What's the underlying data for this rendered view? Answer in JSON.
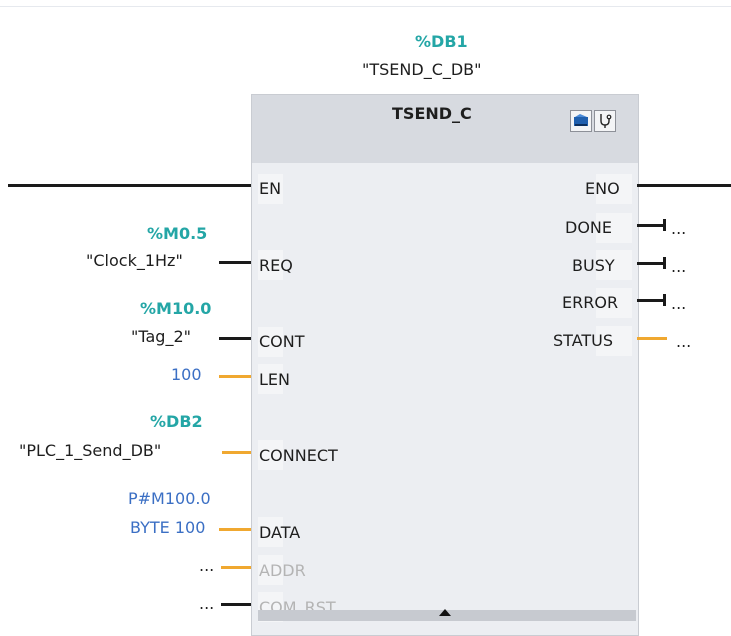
{
  "block": {
    "instance_address": "%DB1",
    "instance_name": "\"TSEND_C_DB\"",
    "type_name": "TSEND_C",
    "icons": [
      "open-block-icon",
      "diagnostics-icon"
    ]
  },
  "inputs": {
    "en": "EN",
    "req": {
      "pin": "REQ",
      "address": "%M0.5",
      "tag": "\"Clock_1Hz\""
    },
    "cont": {
      "pin": "CONT",
      "address": "%M10.0",
      "tag": "\"Tag_2\""
    },
    "len": {
      "pin": "LEN",
      "value": "100"
    },
    "connect": {
      "pin": "CONNECT",
      "address": "%DB2",
      "tag": "\"PLC_1_Send_DB\""
    },
    "data": {
      "pin": "DATA",
      "line1": "P#M100.0",
      "line2": "BYTE 100"
    },
    "addr": {
      "pin": "ADDR",
      "value": "..."
    },
    "com_rst": {
      "pin": "COM_RST",
      "value": "..."
    }
  },
  "outputs": {
    "eno": "ENO",
    "done": {
      "pin": "DONE",
      "value": "..."
    },
    "busy": {
      "pin": "BUSY",
      "value": "..."
    },
    "error": {
      "pin": "ERROR",
      "value": "..."
    },
    "status": {
      "pin": "STATUS",
      "value": "..."
    }
  },
  "colors": {
    "address": "#24a6a6",
    "literal": "#3b6fc4",
    "bool_wire": "#1a1a1a",
    "data_wire": "#f0a830",
    "block_body": "#eceef2",
    "block_header": "#d7dae0"
  }
}
